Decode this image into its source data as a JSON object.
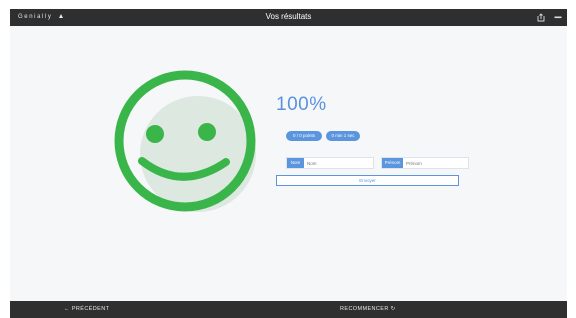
{
  "app": {
    "brand": "Genially",
    "title": "Vos résultats"
  },
  "topbar": {
    "icons": [
      "share-icon",
      "menu-icon"
    ]
  },
  "result": {
    "score": "100%",
    "points": "0 / 0 points",
    "time": "0 min 1 sec"
  },
  "form": {
    "name_label": "Nom",
    "name_placeholder": "Nom",
    "surname_label": "Prénom",
    "surname_placeholder": "Prénom",
    "submit_label": "Envoyer"
  },
  "footer": {
    "prev_label": "← PRÉCÉDENT",
    "restart_label": "RECOMMENCER ↻"
  },
  "colors": {
    "accent": "#5b95de",
    "smiley": "#3ab54a",
    "bar": "#2f2f2f"
  }
}
